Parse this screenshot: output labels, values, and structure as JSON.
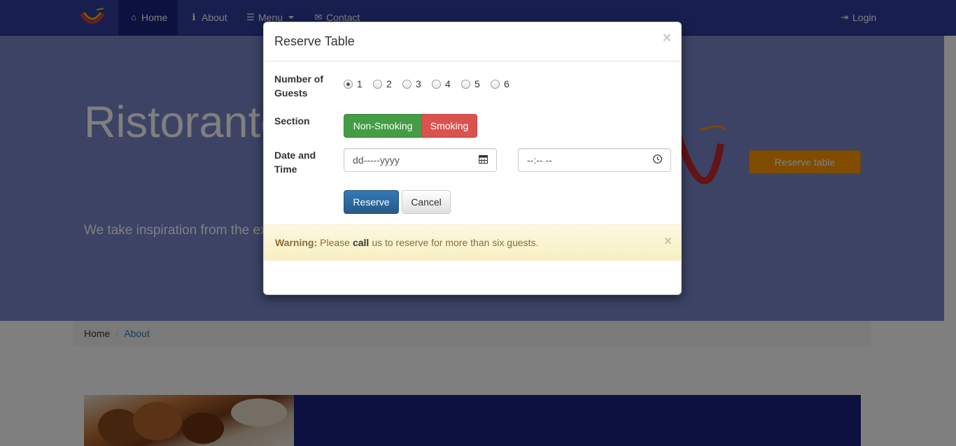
{
  "navbar": {
    "logo_icon": "restaurant-logo",
    "items": [
      {
        "label": "Home",
        "icon": "home-icon"
      },
      {
        "label": "About",
        "icon": "info-icon"
      },
      {
        "label": "Menu",
        "icon": "list-icon"
      },
      {
        "label": "Contact",
        "icon": "envelope-icon"
      }
    ],
    "login": {
      "label": "Login",
      "icon": "login-icon"
    }
  },
  "jumbotron": {
    "title": "Ristorante",
    "text": "We take inspiration from the experience. Our lipsmacking",
    "reserve_button": "Reserve table"
  },
  "breadcrumb": {
    "items": [
      "Home",
      "About"
    ]
  },
  "modal": {
    "title": "Reserve Table",
    "close": "×",
    "guests": {
      "label": "Number of Guests",
      "options": [
        "1",
        "2",
        "3",
        "4",
        "5",
        "6"
      ],
      "selected": "1"
    },
    "section": {
      "label": "Section",
      "non_smoking": "Non-Smoking",
      "smoking": "Smoking"
    },
    "datetime": {
      "label": "Date and Time",
      "date_placeholder": "dd-----yyyy",
      "time_placeholder": "--:-- --"
    },
    "reserve_button": "Reserve",
    "cancel_button": "Cancel",
    "alert": {
      "strong": "Warning:",
      "prefix": "Please",
      "call": "call",
      "suffix": "us to reserve for more than six guests.",
      "close": "×"
    }
  },
  "colors": {
    "navbar": "#303F9F",
    "jumbotron": "#7986CB",
    "accent": "#FF9800"
  }
}
